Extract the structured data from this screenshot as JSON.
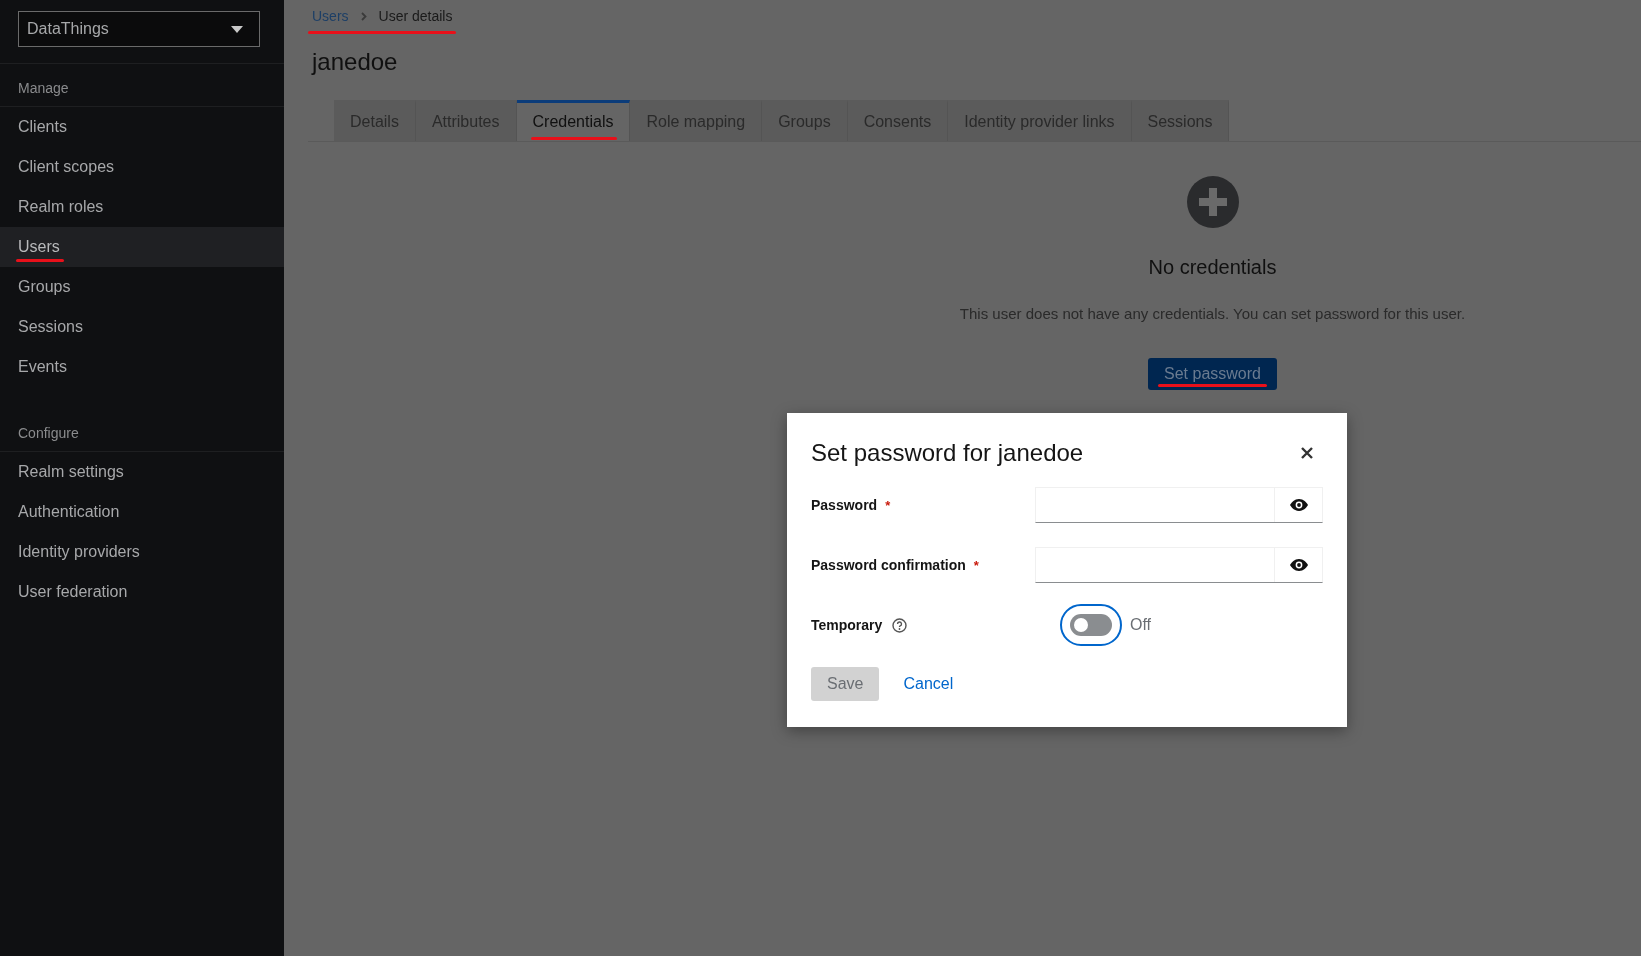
{
  "sidebar": {
    "realm_selector": {
      "value": "DataThings"
    },
    "sections": [
      {
        "heading": "Manage",
        "items": [
          {
            "label": "Clients",
            "selected": false
          },
          {
            "label": "Client scopes",
            "selected": false
          },
          {
            "label": "Realm roles",
            "selected": false
          },
          {
            "label": "Users",
            "selected": true
          },
          {
            "label": "Groups",
            "selected": false
          },
          {
            "label": "Sessions",
            "selected": false
          },
          {
            "label": "Events",
            "selected": false
          }
        ]
      },
      {
        "heading": "Configure",
        "items": [
          {
            "label": "Realm settings",
            "selected": false
          },
          {
            "label": "Authentication",
            "selected": false
          },
          {
            "label": "Identity providers",
            "selected": false
          },
          {
            "label": "User federation",
            "selected": false
          }
        ]
      }
    ]
  },
  "breadcrumb": [
    {
      "label": "Users",
      "link": true
    },
    {
      "label": "User details",
      "link": false
    }
  ],
  "page_title": "janedoe",
  "tabs": [
    {
      "label": "Details",
      "selected": false
    },
    {
      "label": "Attributes",
      "selected": false
    },
    {
      "label": "Credentials",
      "selected": true
    },
    {
      "label": "Role mapping",
      "selected": false
    },
    {
      "label": "Groups",
      "selected": false
    },
    {
      "label": "Consents",
      "selected": false
    },
    {
      "label": "Identity provider links",
      "selected": false
    },
    {
      "label": "Sessions",
      "selected": false
    }
  ],
  "empty_state": {
    "title": "No credentials",
    "text": "This user does not have any credentials. You can set password for this user.",
    "button": "Set password"
  },
  "dialog": {
    "title": "Set password for janedoe",
    "fields": [
      {
        "kind": "password",
        "label": "Password",
        "required_mark": "*"
      },
      {
        "kind": "password",
        "label": "Password confirmation",
        "required_mark": "*"
      },
      {
        "kind": "switch",
        "label": "Temporary",
        "on": false,
        "state_label": "Off"
      }
    ],
    "buttons": [
      {
        "label": "Save",
        "kind": "primary",
        "disabled": true
      },
      {
        "label": "Cancel",
        "kind": "link",
        "disabled": false
      }
    ]
  }
}
